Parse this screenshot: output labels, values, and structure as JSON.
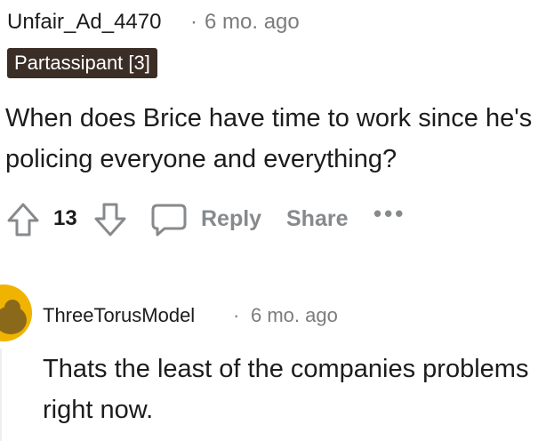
{
  "comment": {
    "username": "Unfair_Ad_4470",
    "separator": "·",
    "timestamp": "6 mo. ago",
    "flair": "Partassipant [3]",
    "body": "When does Brice have time to work since he's policing everyone and everything?",
    "votes": "13",
    "actions": {
      "reply": "Reply",
      "share": "Share",
      "more": "•••"
    },
    "icons": {
      "upvote": "upvote-arrow-icon",
      "downvote": "downvote-arrow-icon",
      "reply": "speech-bubble-icon",
      "more": "ellipsis-icon"
    }
  },
  "reply": {
    "username": "ThreeTorusModel",
    "separator": "·",
    "timestamp": "6 mo. ago",
    "body": "Thats the least of the companies problems right now.",
    "avatar_icon": "user-avatar-icon"
  },
  "colors": {
    "flair_bg": "#3a2e27",
    "muted": "#878a8c",
    "avatar": "#f0b400"
  }
}
